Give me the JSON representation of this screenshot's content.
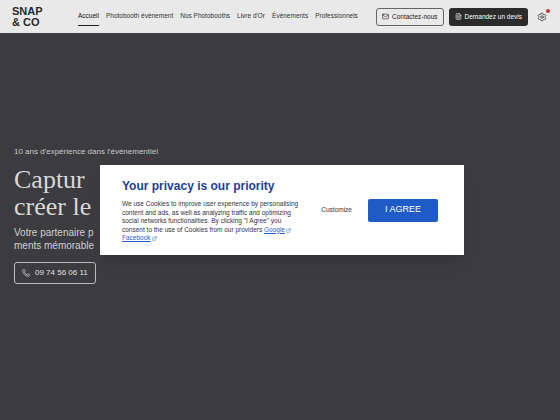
{
  "header": {
    "logo": [
      "SNAP",
      "& CO"
    ],
    "nav": [
      {
        "label": "Accueil",
        "selected": true
      },
      {
        "label": "Photobooth événement",
        "selected": false
      },
      {
        "label": "Nos Photobooths",
        "selected": false
      },
      {
        "label": "Livre d'Or",
        "selected": false
      },
      {
        "label": "Événements",
        "selected": false
      },
      {
        "label": "Professionnels",
        "selected": false
      }
    ],
    "contact_button": "Contactez-nous",
    "quote_button": "Demandez un devis",
    "settings": {
      "notification": true
    }
  },
  "hero": {
    "eyebrow": "10 ans d'expérience dans l'événementiel",
    "heading": [
      "Captur",
      "créer le"
    ],
    "subtitle": [
      "Votre partenaire p",
      "ments mémorable"
    ],
    "phone": "09 74 56 06 11"
  },
  "cookie_dialog": {
    "title": "Your privacy is our priority",
    "body": "We use Cookies to improve user experience by personalising content and ads, as well as analyzing traffic and optimizing social networks functionalities. By clicking \"I Agree\" you consent to the use of Cookies from our providers",
    "links": [
      "Google",
      "Facebook"
    ],
    "customize": "Customize",
    "agree": "I AGREE"
  }
}
